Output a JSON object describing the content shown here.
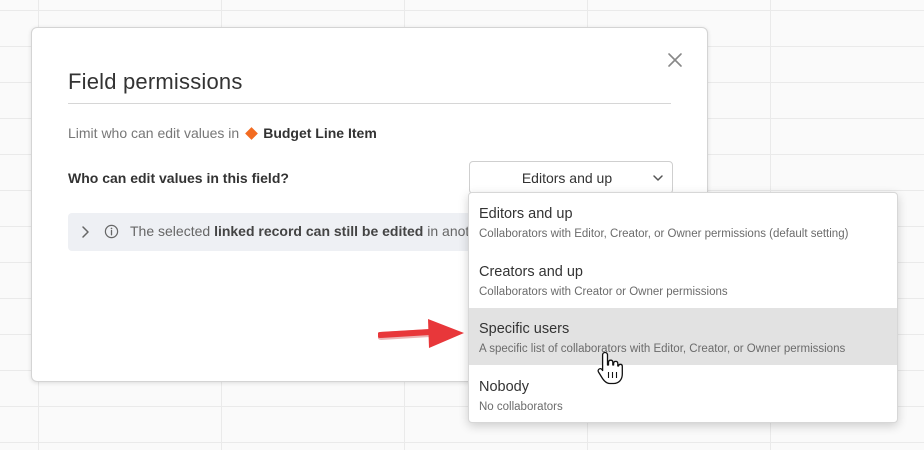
{
  "dialog": {
    "title": "Field permissions",
    "subtitle_prefix": "Limit who can edit values in",
    "table_name": "Budget Line Item",
    "question_label": "Who can edit values in this field?",
    "selected_value": "Editors and up",
    "info_bar": {
      "text_start": "The selected ",
      "text_bold": "linked record can still be edited",
      "text_end": " in anot"
    }
  },
  "dropdown": {
    "options": [
      {
        "title": "Editors and up",
        "description": "Collaborators with Editor, Creator, or Owner permissions (default setting)"
      },
      {
        "title": "Creators and up",
        "description": "Collaborators with Creator or Owner permissions"
      },
      {
        "title": "Specific users",
        "description": "A specific list of collaborators with Editor, Creator, or Owner permissions"
      },
      {
        "title": "Nobody",
        "description": "No collaborators"
      }
    ],
    "highlighted_option": "Specific users"
  },
  "colors": {
    "table_accent": "#f26b21",
    "annotation_arrow": "#e8373a",
    "highlight_row": "#e2e2e2",
    "info_bar_bg": "#eef0f4"
  },
  "icons": [
    "close-icon",
    "diamond-icon",
    "chevron-down-icon",
    "chevron-right-icon",
    "info-icon",
    "hand-cursor-icon",
    "annotation-arrow"
  ]
}
